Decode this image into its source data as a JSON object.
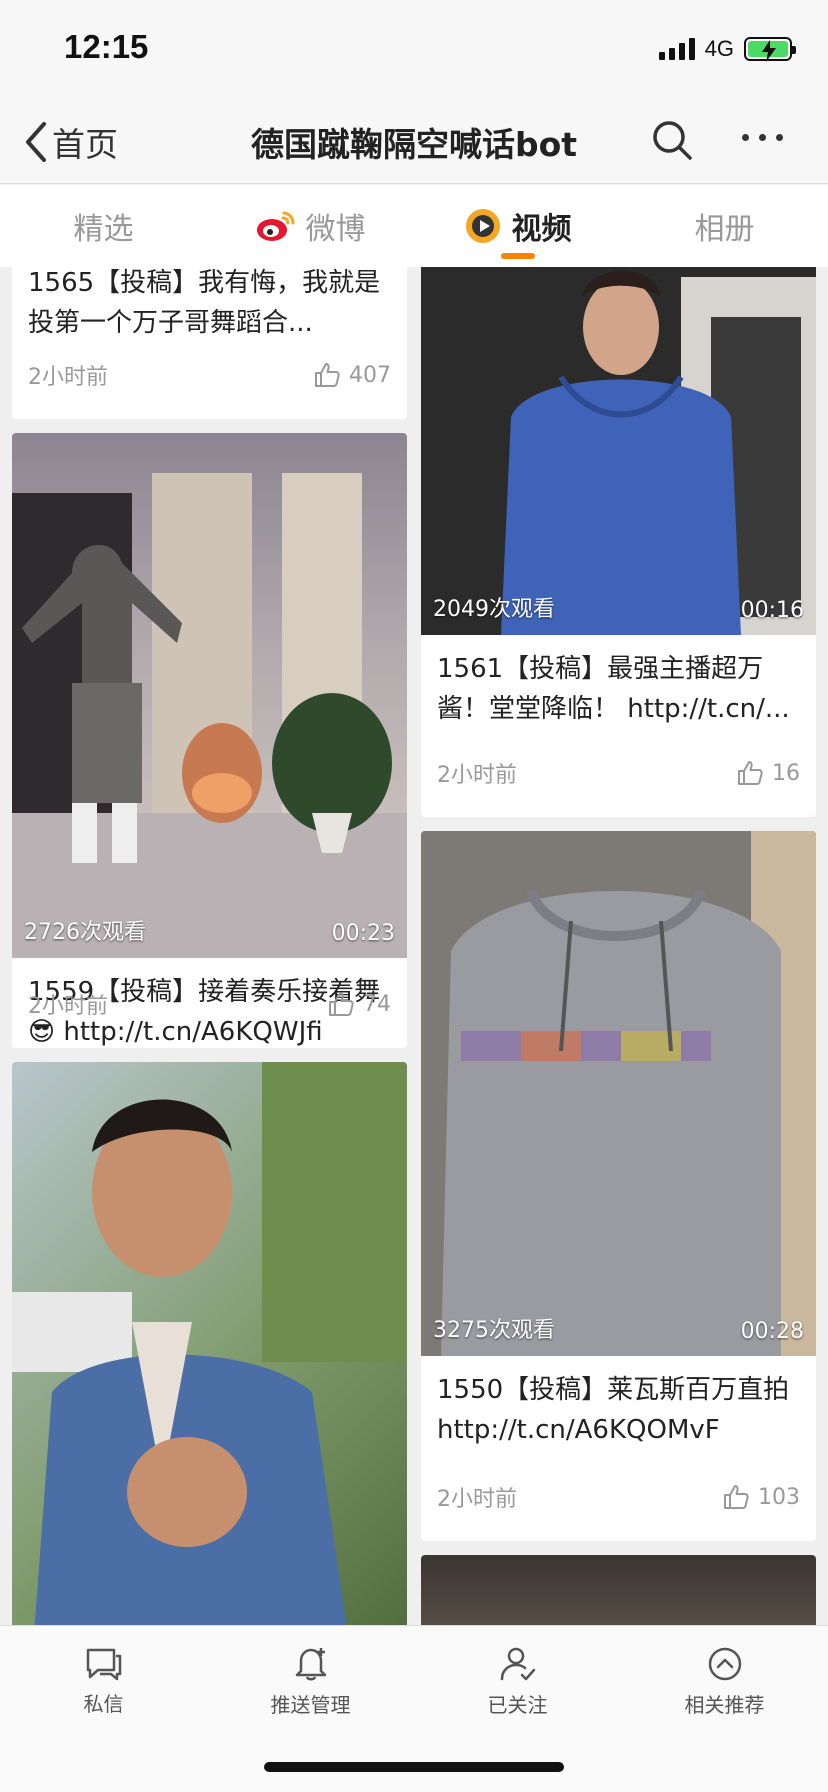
{
  "status_bar": {
    "time": "12:15",
    "network": "4G"
  },
  "nav": {
    "back_label": "首页",
    "title": "德国蹴鞠隔空喊话bot"
  },
  "tabs": [
    {
      "label": "精选",
      "active": false
    },
    {
      "label": "微博",
      "active": false
    },
    {
      "label": "视频",
      "active": true
    },
    {
      "label": "相册",
      "active": false
    }
  ],
  "feed": {
    "left": [
      {
        "text": "1565【投稿】我有悔，我就是投第一个万子哥舞蹈合...",
        "time": "2小时前",
        "likes": "407"
      },
      {
        "views": "2726次观看",
        "duration": "00:23",
        "text": "1559【投稿】接着奏乐接着舞😎 http://t.cn/A6KQWJfi",
        "time": "2小时前",
        "likes": "74"
      },
      {
        "views": "",
        "duration": "",
        "text": "",
        "time": "",
        "likes": ""
      }
    ],
    "right": [
      {
        "views": "2049次观看",
        "duration": "00:16",
        "text": "1561【投稿】最强主播超万酱！堂堂降临！ http://t.cn/...",
        "time": "2小时前",
        "likes": "16"
      },
      {
        "views": "3275次观看",
        "duration": "00:28",
        "text": "1550【投稿】莱瓦斯百万直拍 http://t.cn/A6KQOMvF",
        "time": "2小时前",
        "likes": "103"
      }
    ]
  },
  "bottom_bar": [
    {
      "label": "私信",
      "icon": "message-icon"
    },
    {
      "label": "推送管理",
      "icon": "bell-icon"
    },
    {
      "label": "已关注",
      "icon": "user-check-icon"
    },
    {
      "label": "相关推荐",
      "icon": "chevron-up-circle-icon"
    }
  ]
}
